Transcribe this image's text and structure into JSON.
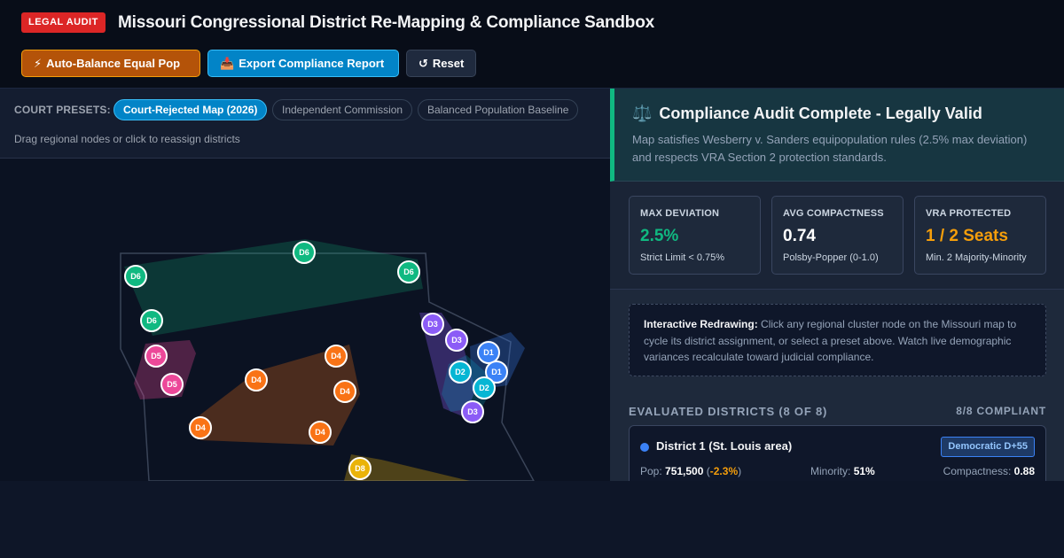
{
  "header": {
    "badge": "LEGAL AUDIT",
    "title": "Missouri Congressional District Re-Mapping & Compliance Sandbox"
  },
  "toolbar": {
    "auto_balance_icon": "⚡",
    "auto_balance_label": "Auto-Balance Equal Pop",
    "export_icon": "📥",
    "export_label": "Export Compliance Report",
    "reset_icon": "↺",
    "reset_label": "Reset"
  },
  "presets": {
    "label": "COURT PRESETS:",
    "items": [
      "Court-Rejected Map (2026)",
      "Independent Commission",
      "Balanced Population Baseline"
    ],
    "active": "Court-Rejected Map (2026)"
  },
  "map": {
    "hint": "Drag regional nodes or click to reassign districts",
    "district_colors": {
      "D1": "#3b82f6",
      "D2": "#06b6d4",
      "D3": "#8b5cf6",
      "D4": "#f97316",
      "D5": "#ec4899",
      "D6": "#10b981",
      "D8": "#eab308"
    },
    "nodes": [
      "D6",
      "D6",
      "D6",
      "D6",
      "D5",
      "D5",
      "D4",
      "D4",
      "D4",
      "D4",
      "D4",
      "D3",
      "D3",
      "D3",
      "D1",
      "D1",
      "D2",
      "D2",
      "D8"
    ]
  },
  "audit": {
    "icon": "⚖️",
    "title": "Compliance Audit Complete - Legally Valid",
    "text": "Map satisfies Wesberry v. Sanders equipopulation rules (2.5% max deviation) and respects VRA Section 2 protection standards."
  },
  "metrics": [
    {
      "label": "MAX DEVIATION",
      "value": "2.5%",
      "sub": "Strict Limit < 0.75%",
      "color": "#10b981"
    },
    {
      "label": "AVG COMPACTNESS",
      "value": "0.74",
      "sub": "Polsby-Popper (0-1.0)",
      "color": "#ffffff"
    },
    {
      "label": "VRA PROTECTED",
      "value": "1 / 2 Seats",
      "sub": "Min. 2 Majority-Minority",
      "color": "#f59e0b"
    }
  ],
  "info": {
    "bold": "Interactive Redrawing:",
    "text": " Click any regional cluster node on the Missouri map to cycle its district assignment, or select a preset above. Watch live demographic variances recalculate toward judicial compliance."
  },
  "districts_header": {
    "title": "EVALUATED DISTRICTS (8 OF 8)",
    "status": "8/8 COMPLIANT"
  },
  "districts": [
    {
      "name": "District 1 (St. Louis area)",
      "lean": "Democratic D+55",
      "color": "#3b82f6",
      "pop_label": "Pop:",
      "pop": "751,500",
      "deviation": "-2.3%",
      "minority_label": "Minority:",
      "minority": "51%",
      "compactness_label": "Compactness:",
      "compactness": "0.88"
    }
  ]
}
